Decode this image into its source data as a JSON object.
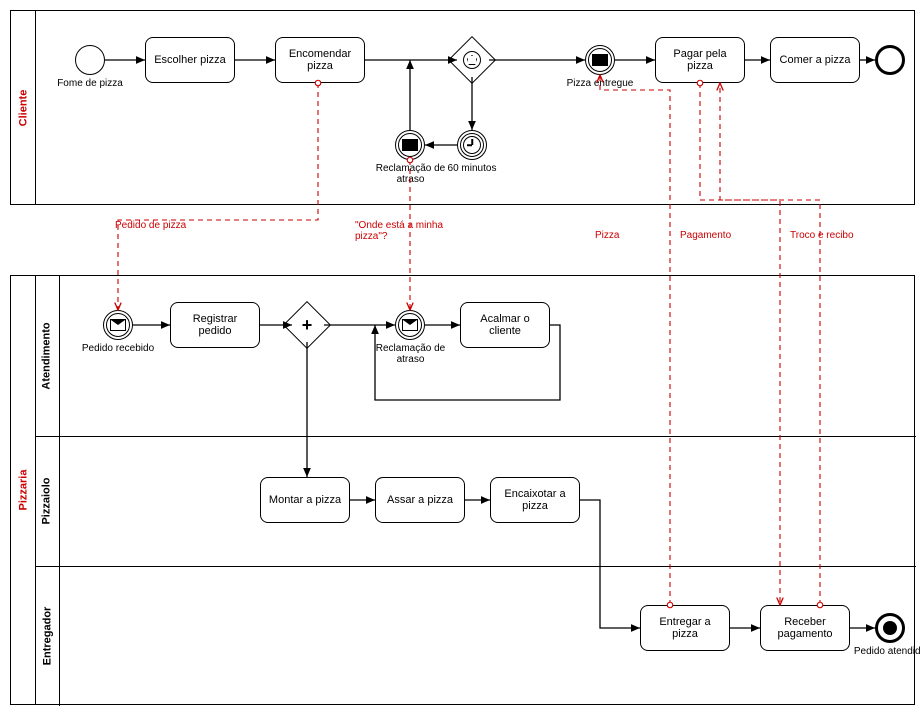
{
  "pools": {
    "cliente": "Cliente",
    "pizzaria": "Pizzaria"
  },
  "lanes": {
    "atendimento": "Atendimento",
    "pizzaiolo": "Pizzaiolo",
    "entregador": "Entregador"
  },
  "tasks": {
    "escolher": "Escolher pizza",
    "encomendar": "Encomendar pizza",
    "reclamacao": "Reclamação de atraso",
    "min60": "60 minutos",
    "entregue": "Pizza entregue",
    "pagar": "Pagar pela pizza",
    "comer": "Comer a pizza",
    "fome": "Fome de pizza",
    "registrar": "Registrar pedido",
    "recebido": "Pedido recebido",
    "reclamacao2": "Reclamação de atraso",
    "acalmar": "Acalmar o cliente",
    "montar": "Montar a pizza",
    "assar": "Assar a pizza",
    "encaixotar": "Encaixotar a pizza",
    "entregar": "Entregar a pizza",
    "receber": "Receber pagamento",
    "atendido": "Pedido atendido"
  },
  "messages": {
    "pedido": "Pedido de pizza",
    "onde": "\"Onde está a minha pizza\"?",
    "pizza": "Pizza",
    "pagamento": "Pagamento",
    "troco": "Troco e recibo"
  }
}
